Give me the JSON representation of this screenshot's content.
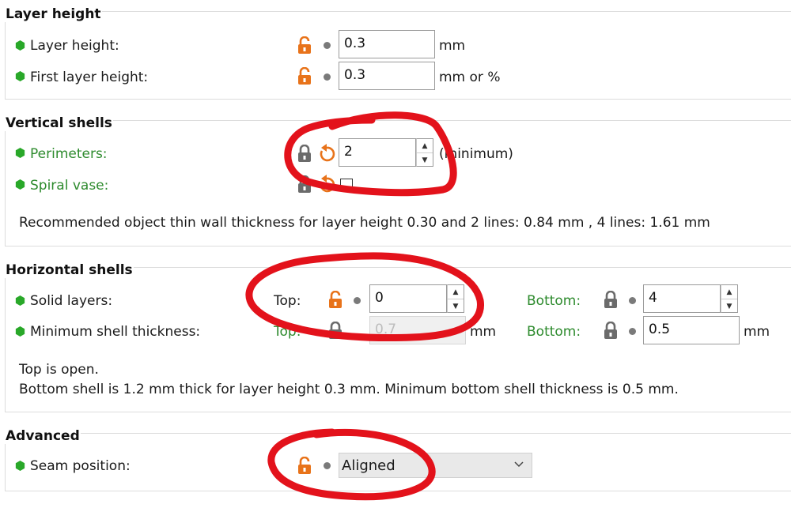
{
  "layer_height": {
    "title": "Layer height",
    "layer_height": {
      "label": "Layer height:",
      "value": "0.3",
      "unit": "mm"
    },
    "first_layer_height": {
      "label": "First layer height:",
      "value": "0.3",
      "unit": "mm or %"
    }
  },
  "vertical_shells": {
    "title": "Vertical shells",
    "perimeters": {
      "label": "Perimeters:",
      "value": "2",
      "suffix": "(minimum)"
    },
    "spiral_vase": {
      "label": "Spiral vase:",
      "checked": false
    },
    "note": "Recommended object thin wall thickness for layer height 0.30 and 2 lines: 0.84 mm , 4 lines: 1.61 mm"
  },
  "horizontal_shells": {
    "title": "Horizontal shells",
    "solid_layers": {
      "label": "Solid layers:",
      "top_label": "Top:",
      "top_value": "0",
      "bottom_label": "Bottom:",
      "bottom_value": "4"
    },
    "min_shell": {
      "label": "Minimum shell thickness:",
      "top_label": "Top:",
      "top_value": "0.7",
      "top_unit": "mm",
      "bottom_label": "Bottom:",
      "bottom_value": "0.5",
      "bottom_unit": "mm"
    },
    "note_line1": "Top is open.",
    "note_line2": "Bottom shell is 1.2 mm thick for layer height 0.3 mm. Minimum bottom shell thickness is 0.5 mm."
  },
  "advanced": {
    "title": "Advanced",
    "seam_position": {
      "label": "Seam position:",
      "value": "Aligned"
    }
  },
  "colors": {
    "accent_orange": "#e8731a",
    "setting_green": "#2e8b2e",
    "annotation_red": "#e3121b",
    "lock_gray": "#6b6b6b"
  },
  "icons": [
    "green-hexagon-bullet",
    "unlocked-padlock-icon",
    "locked-padlock-icon",
    "reset-arrow-icon",
    "gray-dot-icon",
    "chevron-down-icon"
  ]
}
